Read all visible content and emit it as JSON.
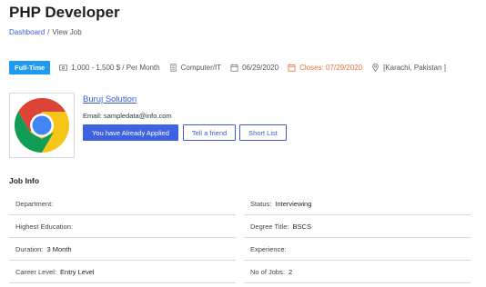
{
  "page": {
    "title": "PHP Developer"
  },
  "breadcrumb": {
    "home": "Dashboard",
    "separator": "/",
    "current": "View Job"
  },
  "meta": {
    "job_type": "Full-Time",
    "salary": "1,000 - 1,500 $ / Per Month",
    "category": "Computer/IT",
    "posted": "06/29/2020",
    "closes": "Closes: 07/29/2020",
    "location": "[Karachi, Pakistan ]",
    "badge_color": "#1d9bf0",
    "closes_color": "#e8703a"
  },
  "company": {
    "name": "Buruj Solution",
    "email": "Email: sampledata@info.com",
    "logo_icon": "chrome-logo-icon"
  },
  "actions": {
    "applied": "You have Already Applied",
    "tell_friend": "Tell a friend",
    "short_list": "Short List",
    "accent": "#3f63e0"
  },
  "job_info": {
    "title": "Job Info",
    "left": [
      {
        "label": "Department:",
        "value": ""
      },
      {
        "label": "Highest Education:",
        "value": ""
      },
      {
        "label": "Duration:",
        "value": "3 Month"
      },
      {
        "label": "Career Level:",
        "value": "Entry Level"
      }
    ],
    "right": [
      {
        "label": "Status:",
        "value": "Interviewing"
      },
      {
        "label": "Degree Title:",
        "value": "BSCS"
      },
      {
        "label": "Experience:",
        "value": ""
      },
      {
        "label": "No of Jobs:",
        "value": "2"
      }
    ]
  }
}
